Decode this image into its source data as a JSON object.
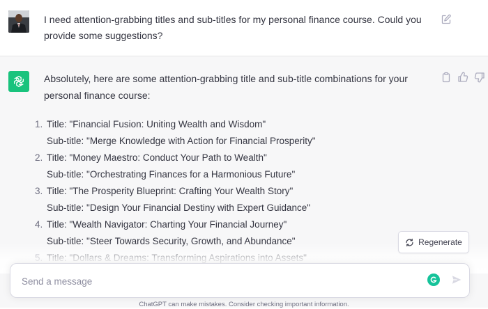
{
  "user_message": {
    "text": "I need attention-grabbing titles and sub-titles for my personal finance course. Could you provide some suggestions?",
    "avatar_icon": "user-avatar-photo",
    "edit_icon": "edit-icon"
  },
  "assistant_message": {
    "intro": "Absolutely, here are some attention-grabbing title and sub-title combinations for your personal finance course:",
    "actions": [
      "clipboard-icon",
      "thumbs-up-icon",
      "thumbs-down-icon"
    ],
    "items": [
      {
        "num": "1.",
        "title": "Title: \"Financial Fusion: Uniting Wealth and Wisdom\"",
        "subtitle": "Sub-title: \"Merge Knowledge with Action for Financial Prosperity\""
      },
      {
        "num": "2.",
        "title": "Title: \"Money Maestro: Conduct Your Path to Wealth\"",
        "subtitle": "Sub-title: \"Orchestrating Finances for a Harmonious Future\""
      },
      {
        "num": "3.",
        "title": "Title: \"The Prosperity Blueprint: Crafting Your Wealth Story\"",
        "subtitle": "Sub-title: \"Design Your Financial Destiny with Expert Guidance\""
      },
      {
        "num": "4.",
        "title": "Title: \"Wealth Navigator: Charting Your Financial Journey\"",
        "subtitle": "Sub-title: \"Steer Towards Security, Growth, and Abundance\""
      },
      {
        "num": "5.",
        "title": "Title: \"Dollars & Dreams: Transforming Aspirations into Assets\"",
        "subtitle": ""
      }
    ]
  },
  "regenerate": {
    "label": "Regenerate",
    "icon": "refresh-icon"
  },
  "composer": {
    "placeholder": "Send a message",
    "value": "",
    "grammarly_icon": "grammarly-icon",
    "send_icon": "send-icon"
  },
  "footer": {
    "disclaimer": "ChatGPT can make mistakes. Consider checking important information."
  },
  "colors": {
    "brand_green": "#19c37d",
    "assistant_bg": "#f7f7f8",
    "text": "#343541"
  }
}
